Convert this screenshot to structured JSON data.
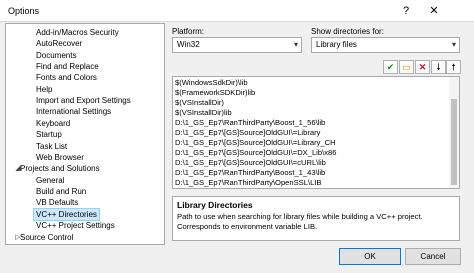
{
  "window": {
    "title": "Options",
    "help_label": "?",
    "close_label": "✕"
  },
  "tree": {
    "items": [
      {
        "label": "Add-in/Macros Security",
        "level": 1
      },
      {
        "label": "AutoRecover",
        "level": 1
      },
      {
        "label": "Documents",
        "level": 1
      },
      {
        "label": "Find and Replace",
        "level": 1
      },
      {
        "label": "Fonts and Colors",
        "level": 1
      },
      {
        "label": "Help",
        "level": 1
      },
      {
        "label": "Import and Export Settings",
        "level": 1
      },
      {
        "label": "International Settings",
        "level": 1
      },
      {
        "label": "Keyboard",
        "level": 1
      },
      {
        "label": "Startup",
        "level": 1
      },
      {
        "label": "Task List",
        "level": 1
      },
      {
        "label": "Web Browser",
        "level": 1
      },
      {
        "label": "Projects and Solutions",
        "level": 0,
        "expander": "◢"
      },
      {
        "label": "General",
        "level": 1
      },
      {
        "label": "Build and Run",
        "level": 1
      },
      {
        "label": "VB Defaults",
        "level": 1
      },
      {
        "label": "VC++ Directories",
        "level": 1,
        "selected": true
      },
      {
        "label": "VC++ Project Settings",
        "level": 1
      },
      {
        "label": "Source Control",
        "level": 0,
        "expander": "▷"
      }
    ]
  },
  "platform": {
    "label": "Platform:",
    "value": "Win32"
  },
  "show_dirs": {
    "label": "Show directories for:",
    "value": "Library files"
  },
  "toolbar": {
    "check": "✔",
    "folder": "▭",
    "delete": "✕",
    "down": "🠗",
    "up": "🠕"
  },
  "directories": [
    "$(WindowsSdkDir)\\lib",
    "$(FrameworkSDKDir)lib",
    "$(VSInstallDir)",
    "$(VSInstallDir)lib",
    "D:\\1_GS_Ep7\\RanThirdParty\\Boost_1_56\\lib",
    "D:\\1_GS_Ep7\\[GS]Source]OldGUI\\=Library",
    "D:\\1_GS_Ep7\\[GS]Source]OldGUI\\=Library_CH",
    "D:\\1_GS_Ep7\\[GS]Source]OldGUI\\=DX_Lib\\x86",
    "D:\\1_GS_Ep7\\[GS]Source]OldGUI\\=cURL\\lib",
    "D:\\1_GS_Ep7\\RanThirdParty\\Boost_1_43\\lib",
    "D:\\1_GS_Ep7\\RanThirdParty\\OpenSSL\\LIB"
  ],
  "description": {
    "title": "Library Directories",
    "line1": "Path to use when searching for library files while building a VC++ project.",
    "line2": "Corresponds to environment variable LIB."
  },
  "buttons": {
    "ok": "OK",
    "cancel": "Cancel"
  }
}
